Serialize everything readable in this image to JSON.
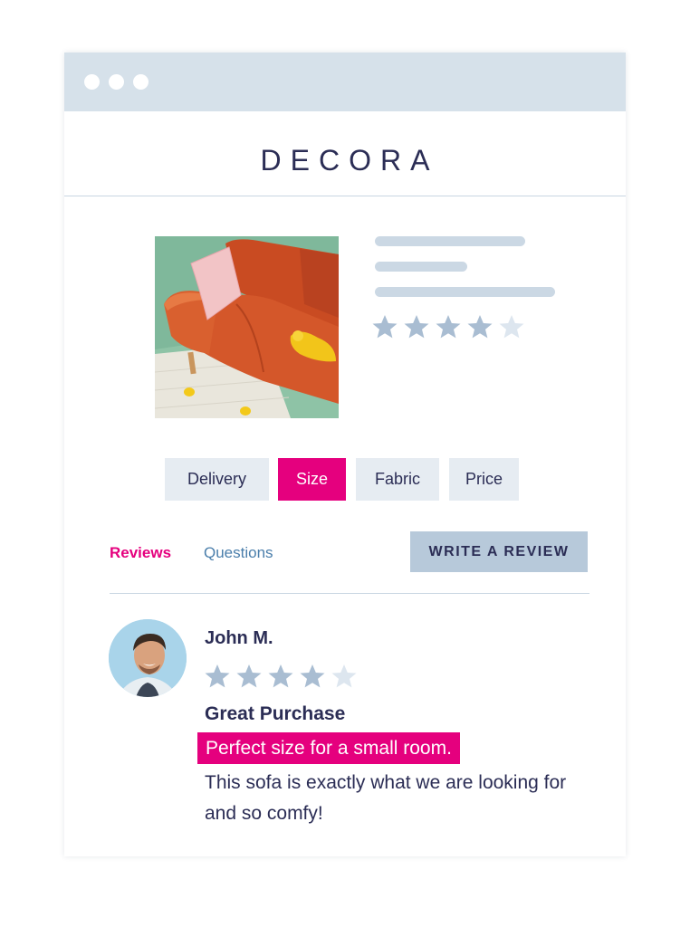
{
  "brand": {
    "name": "DECORA"
  },
  "product": {
    "image_alt": "orange sofa with pink pillow",
    "rating": 4,
    "max_rating": 5
  },
  "options": [
    {
      "label": "Delivery",
      "active": false
    },
    {
      "label": "Size",
      "active": true
    },
    {
      "label": "Fabric",
      "active": false
    },
    {
      "label": "Price",
      "active": false
    }
  ],
  "tabs": [
    {
      "label": "Reviews",
      "active": true
    },
    {
      "label": "Questions",
      "active": false
    }
  ],
  "write_review_label": "WRITE A REVIEW",
  "review": {
    "author": "John M.",
    "rating": 4,
    "max_rating": 5,
    "title": "Great Purchase",
    "highlight": "Perfect size for a small room.",
    "body": "This sofa is exactly what we are looking for and so comfy!"
  },
  "colors": {
    "accent": "#e5007e",
    "navy": "#2b2d55",
    "star_filled": "#a9bdd2",
    "star_empty": "#dde6ef",
    "titlebar": "#d6e1ea"
  }
}
